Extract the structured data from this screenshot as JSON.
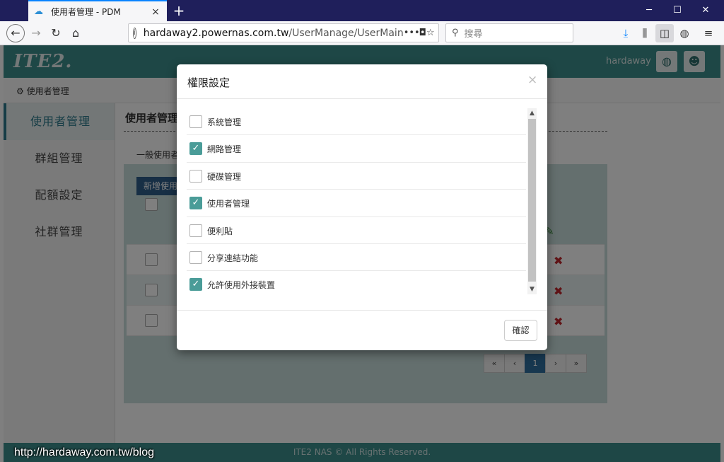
{
  "browser": {
    "tab_title": "使用者管理 - PDM",
    "tab_close": "×",
    "new_tab": "+",
    "url_domain": "hardaway2.powernas.com.tw",
    "url_path": "/UserManage/UserMain",
    "search_placeholder": "搜尋",
    "window_controls": {
      "minimize": "─",
      "maximize": "☐",
      "close": "✕"
    }
  },
  "app": {
    "logo": "ITE2.",
    "username": "hardaway",
    "breadcrumb": "使用者管理",
    "sidebar": [
      {
        "label": "使用者管理",
        "active": true
      },
      {
        "label": "群組管理",
        "active": false
      },
      {
        "label": "配額設定",
        "active": false
      },
      {
        "label": "社群管理",
        "active": false
      }
    ],
    "content_title": "使用者管理",
    "sub_tab": "一般使用者",
    "add_button": "新增使用",
    "pagination": {
      "first": "«",
      "prev": "‹",
      "current": "1",
      "next": "›",
      "last": "»"
    },
    "footer": "ITE2 NAS © All Rights Reserved."
  },
  "modal": {
    "title": "權限設定",
    "close": "×",
    "permissions": [
      {
        "label": "系統管理",
        "checked": false
      },
      {
        "label": "網路管理",
        "checked": true
      },
      {
        "label": "硬碟管理",
        "checked": false
      },
      {
        "label": "使用者管理",
        "checked": true
      },
      {
        "label": "便利貼",
        "checked": false
      },
      {
        "label": "分享連結功能",
        "checked": false
      },
      {
        "label": "允許使用外接裝置",
        "checked": true
      }
    ],
    "confirm_button": "確認"
  },
  "watermark": "http://hardaway.com.tw/blog",
  "colors": {
    "accent": "#3d8f8c",
    "checkbox_on": "#4a9c98",
    "tabbar": "#1f1f5b"
  }
}
